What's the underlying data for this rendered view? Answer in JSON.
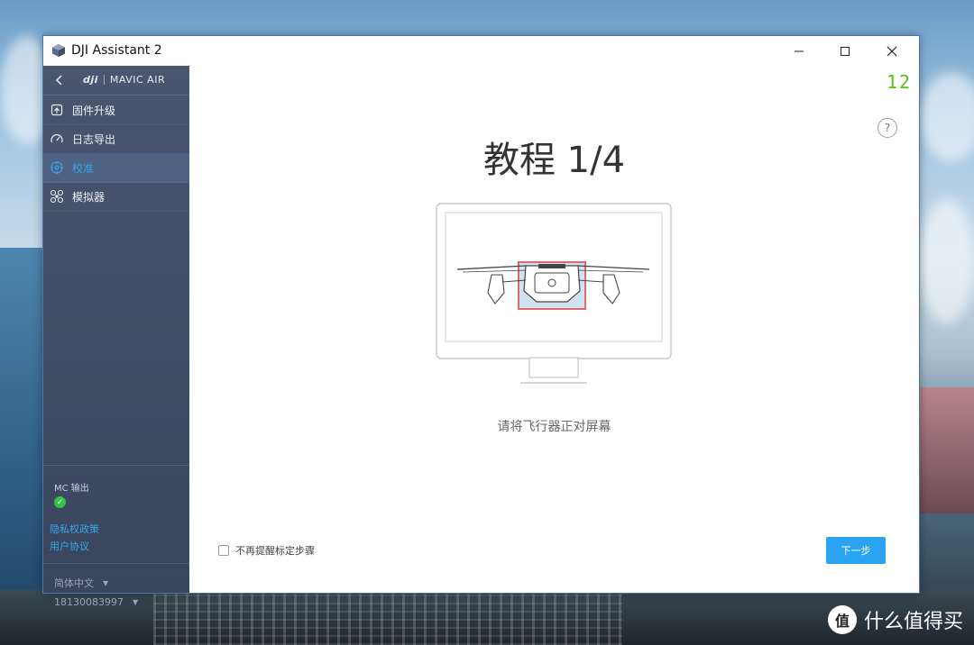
{
  "window": {
    "title": "DJI Assistant 2"
  },
  "sidebar": {
    "brand": {
      "logo": "dji",
      "model": "MAVIC AIR"
    },
    "items": [
      {
        "label": "固件升级",
        "icon": "firmware-icon"
      },
      {
        "label": "日志导出",
        "icon": "gauge-icon"
      },
      {
        "label": "校准",
        "icon": "calibrate-icon",
        "active": true
      },
      {
        "label": "模拟器",
        "icon": "drone-icon"
      }
    ],
    "mc_label": "MC 输出",
    "links": [
      "隐私权政策",
      "用户协议"
    ],
    "language": "简体中文",
    "account": "18130083997"
  },
  "main": {
    "step_badge": "12",
    "title": "教程 1/4",
    "instruction": "请将飞行器正对屏幕",
    "dont_remind": "不再提醒标定步骤",
    "next_button": "下一步"
  },
  "watermark": {
    "badge": "值",
    "text": "什么值得买"
  },
  "colors": {
    "accent": "#2aa4f0",
    "active_nav": "#33a8ea",
    "sidebar": "#434f68",
    "status_ok": "#35c24b",
    "badge_green": "#55c018"
  }
}
